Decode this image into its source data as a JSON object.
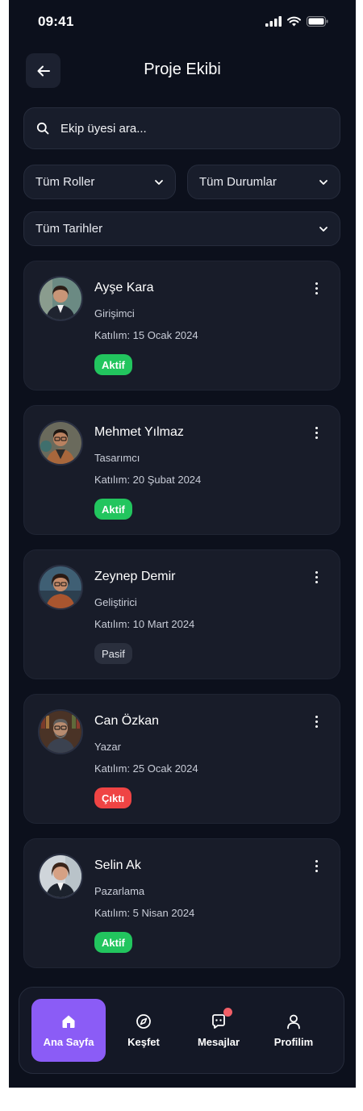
{
  "status_bar": {
    "time": "09:41"
  },
  "header": {
    "title": "Proje Ekibi"
  },
  "search": {
    "placeholder": "Ekip üyesi ara..."
  },
  "filters": {
    "roles": "Tüm Roller",
    "statuses": "Tüm Durumlar",
    "dates": "Tüm Tarihler"
  },
  "members": [
    {
      "name": "Ayşe Kara",
      "role": "Girişimci",
      "joined": "Katılım: 15 Ocak 2024",
      "status": "Aktif"
    },
    {
      "name": "Mehmet Yılmaz",
      "role": "Tasarımcı",
      "joined": "Katılım: 20 Şubat 2024",
      "status": "Aktif"
    },
    {
      "name": "Zeynep Demir",
      "role": "Geliştirici",
      "joined": "Katılım: 10 Mart 2024",
      "status": "Pasif"
    },
    {
      "name": "Can Özkan",
      "role": "Yazar",
      "joined": "Katılım: 25 Ocak 2024",
      "status": "Çıktı"
    },
    {
      "name": "Selin Ak",
      "role": "Pazarlama",
      "joined": "Katılım: 5 Nisan 2024",
      "status": "Aktif"
    }
  ],
  "nav": {
    "home": "Ana Sayfa",
    "explore": "Keşfet",
    "messages": "Mesajlar",
    "profile": "Profilim"
  },
  "colors": {
    "accent": "#8b5cf6",
    "active": "#22c55e",
    "left": "#ef4444",
    "passive": "#2a2f3d",
    "background": "#0c101c"
  }
}
